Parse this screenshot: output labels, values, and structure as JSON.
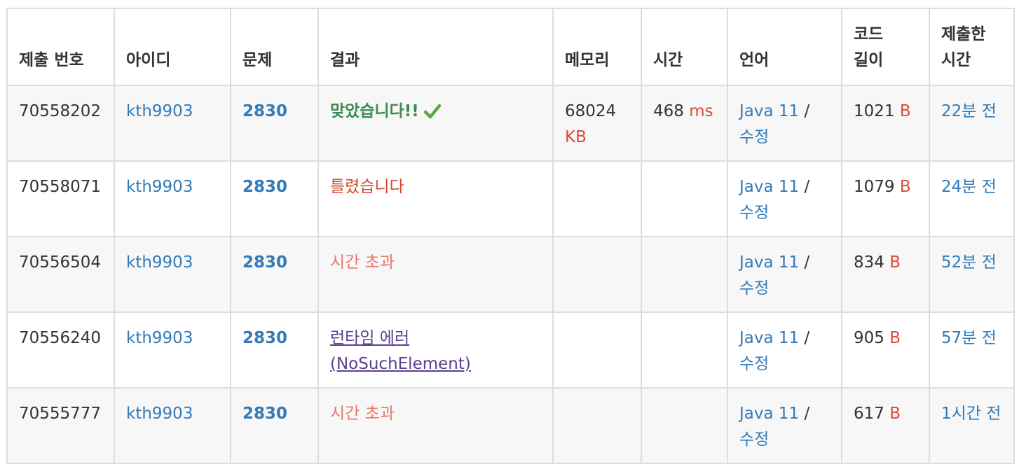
{
  "headers": [
    "제출 번호",
    "아이디",
    "문제",
    "결과",
    "메모리",
    "시간",
    "언어",
    "코드 길이",
    "제출한 시간"
  ],
  "rows": [
    {
      "id": "70558202",
      "user": "kth9903",
      "problem": "2830",
      "result": "맞았습니다!!",
      "result_type": "ac",
      "memory": "68024",
      "memory_unit": "KB",
      "time": "468",
      "time_unit": "ms",
      "lang": "Java 11",
      "edit": "수정",
      "length": "1021",
      "length_unit": "B",
      "submitted": "22분 전"
    },
    {
      "id": "70558071",
      "user": "kth9903",
      "problem": "2830",
      "result": "틀렸습니다",
      "result_type": "wa",
      "memory": "",
      "memory_unit": "",
      "time": "",
      "time_unit": "",
      "lang": "Java 11",
      "edit": "수정",
      "length": "1079",
      "length_unit": "B",
      "submitted": "24분 전"
    },
    {
      "id": "70556504",
      "user": "kth9903",
      "problem": "2830",
      "result": "시간 초과",
      "result_type": "tle",
      "memory": "",
      "memory_unit": "",
      "time": "",
      "time_unit": "",
      "lang": "Java 11",
      "edit": "수정",
      "length": "834",
      "length_unit": "B",
      "submitted": "52분 전"
    },
    {
      "id": "70556240",
      "user": "kth9903",
      "problem": "2830",
      "result": "런타임 에러 (NoSuchElement)",
      "result_type": "rte",
      "memory": "",
      "memory_unit": "",
      "time": "",
      "time_unit": "",
      "lang": "Java 11",
      "edit": "수정",
      "length": "905",
      "length_unit": "B",
      "submitted": "57분 전"
    },
    {
      "id": "70555777",
      "user": "kth9903",
      "problem": "2830",
      "result": "시간 초과",
      "result_type": "tle",
      "memory": "",
      "memory_unit": "",
      "time": "",
      "time_unit": "",
      "lang": "Java 11",
      "edit": "수정",
      "length": "617",
      "length_unit": "B",
      "submitted": "1시간 전"
    }
  ],
  "icons": {
    "accepted": "check-icon"
  },
  "colors": {
    "link": "#337ab7",
    "accepted": "#3b8c50",
    "wrong": "#d3492d",
    "time_limit": "#e8776a",
    "runtime_error": "#5b3f8e",
    "unit": "#dd4b39",
    "border": "#dddddd",
    "stripe": "#f7f7f7"
  }
}
